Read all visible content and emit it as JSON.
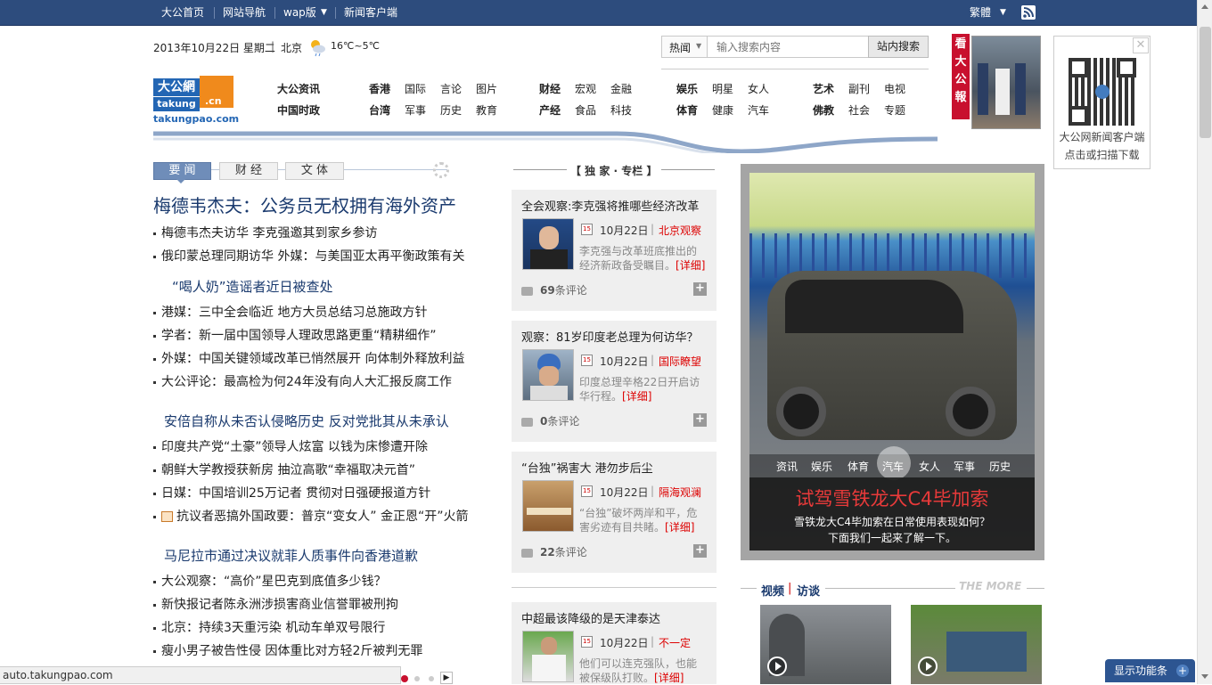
{
  "topbar": {
    "links": [
      "大公首页",
      "网站导航",
      "wap版",
      "新闻客户端"
    ],
    "lang": "繁體"
  },
  "header": {
    "date": "2013年10月22日  星期二",
    "city": "北京",
    "temp": "16℃~5℃",
    "search_type": "热闻",
    "search_placeholder": "输入搜索内容",
    "search_button": "站内搜索",
    "logo_cn": "大公網",
    "logo_en": "takung",
    "logo_cn2": ".cn",
    "logo_domain": "takungpao.com",
    "side_banner": "看大公報"
  },
  "nav": {
    "row1": [
      "大公资讯",
      "香港",
      "国际",
      "言论",
      "图片",
      "财经",
      "宏观",
      "金融",
      "娱乐",
      "明星",
      "女人",
      "艺术",
      "副刊",
      "电视"
    ],
    "row2": [
      "中国时政",
      "台湾",
      "军事",
      "历史",
      "教育",
      "产经",
      "食品",
      "科技",
      "体育",
      "健康",
      "汽车",
      "佛教",
      "社会",
      "专题"
    ]
  },
  "qr": {
    "line1": "大公网新闻客户端",
    "line2": "点击或扫描下载"
  },
  "news_tabs": [
    "要 闻",
    "财 经",
    "文 体"
  ],
  "top_headline": "梅德韦杰夫：公务员无权拥有海外资产",
  "news_items": [
    "梅德韦杰夫访华 李克强邀其到家乡参访",
    "俄印蒙总理同期访华 外媒：与美国亚太再平衡政策有关",
    "港媒：三中全会临近 地方大员总结习总施政方针",
    "学者：新一届中国领导人理政思路更重“精耕细作”",
    "外媒：中国关键领域改革已悄然展开 向体制外释放利益",
    "大公评论：最高检为何24年没有向人大汇报反腐工作",
    "印度共产党“土豪”领导人炫富 以钱为床惨遭开除",
    "朝鲜大学教授获新房 抽泣高歌“幸福取决元首”",
    "日媒：中国培训25万记者 贯彻对日强硬报道方针",
    "抗议者恶搞外国政要：普京“变女人” 金正恩“开”火箭",
    "大公观察：“高价”星巴克到底值多少钱？",
    "新快报记者陈永洲涉损害商业信誉罪被刑拘",
    "北京：持续3天重污染 机动车单双号限行",
    "瘦小男子被告性侵 因体重比对方轻2斤被判无罪"
  ],
  "sub_headlines": [
    "“喝人奶”造谣者近日被查处",
    "安倍自称从未否认侵略历史 反对党批其从未承认",
    "马尼拉市通过决议就菲人质事件向香港道歉"
  ],
  "column_title": "【 独 家 · 专栏 】",
  "cards": [
    {
      "title": "全会观察:李克强将推哪些经济改革",
      "date": "10月22日",
      "source": "北京观察",
      "desc": "李克强与改革班底推出的经济新政备受瞩目。",
      "more": "[详细]",
      "comments": "69",
      "comment_label": "条评论"
    },
    {
      "title": "观察：81岁印度老总理为何访华？",
      "date": "10月22日",
      "source": "国际瞭望",
      "desc": "印度总理辛格22日开启访华行程。",
      "more": "[详细]",
      "comments": "0",
      "comment_label": "条评论"
    },
    {
      "title": "“台独”祸害大 港勿步后尘",
      "date": "10月22日",
      "source": "隔海观澜",
      "desc": "“台独”破坏两岸和平，危害劣迹有目共睹。",
      "more": "[详细]",
      "comments": "22",
      "comment_label": "条评论"
    },
    {
      "title": "中超最该降级的是天津泰达",
      "date": "10月22日",
      "source": "不一定",
      "desc": "他们可以连克强队，也能被保级队打败。",
      "more": "[详细]"
    }
  ],
  "slider": {
    "categories": [
      "资讯",
      "娱乐",
      "体育",
      "汽车",
      "女人",
      "军事",
      "历史"
    ],
    "active": "汽车",
    "title": "试驾雪铁龙大C4毕加索",
    "desc1": "雪铁龙大C4毕加索在日常使用表现如何？",
    "desc2": "下面我们一起来了解一下。"
  },
  "video": {
    "title1": "视频",
    "title2": "访谈",
    "more": "THE MORE"
  },
  "statusbar": "auto.takungpao.com",
  "feature_bar": "显示功能条",
  "colors": {
    "topbar": "#2d4c7d",
    "accent_red": "#d81e1e",
    "link_blue": "#1a3a6e"
  }
}
